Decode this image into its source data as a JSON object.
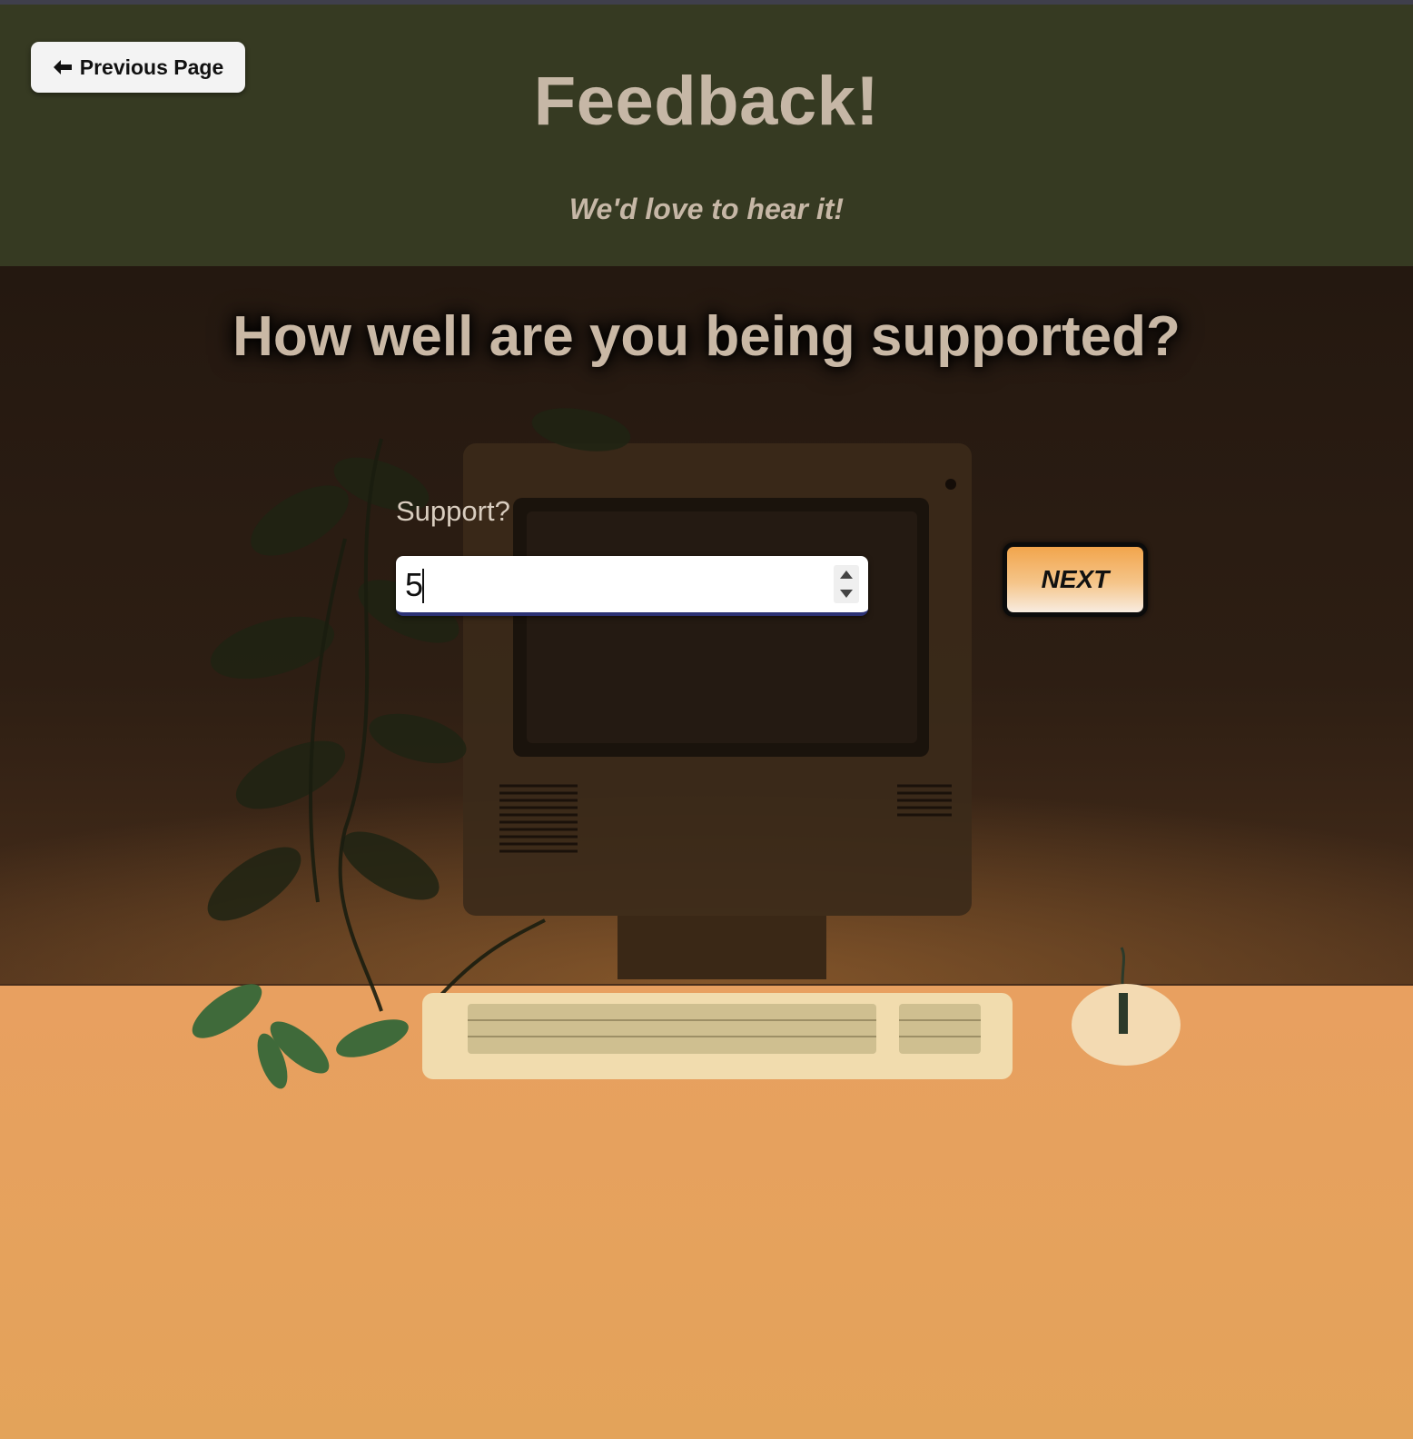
{
  "header": {
    "back_button_label": "Previous Page",
    "title": "Feedback!",
    "subtitle": "We'd love to hear it!"
  },
  "form": {
    "question": "How well are you being supported?",
    "field_label": "Support?",
    "field_value": "5",
    "next_label": "NEXT"
  },
  "icons": {
    "back": "arrow-left-icon",
    "stepper_up": "chevron-up-icon",
    "stepper_down": "chevron-down-icon"
  },
  "colors": {
    "header_bg": "#363a22",
    "title_text": "#c6b7a6",
    "desk_orange": "#e2a15a",
    "next_button_top": "#f2a54c",
    "input_underline": "#2c3275"
  }
}
